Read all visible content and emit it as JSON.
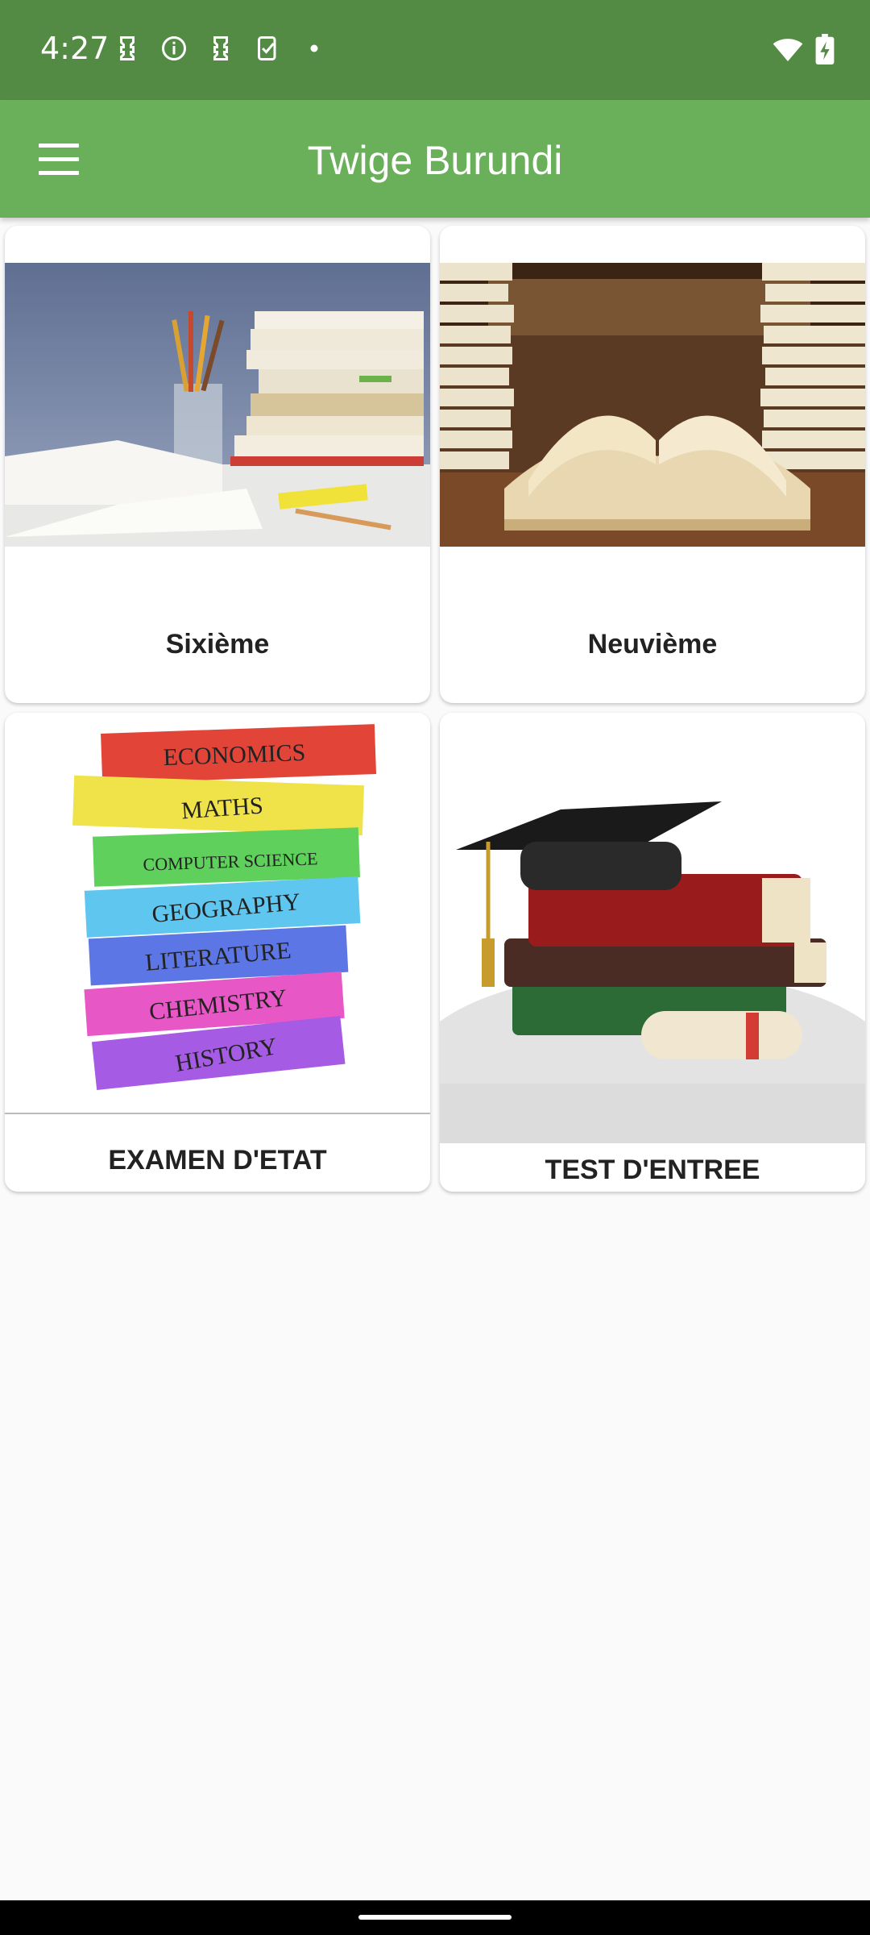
{
  "status_bar": {
    "time": "4:27",
    "left_icons": [
      "sim-icon",
      "info-icon",
      "sim-icon",
      "task-icon",
      "dot-icon"
    ],
    "right_icons": [
      "wifi-icon",
      "battery-charging-icon"
    ]
  },
  "app_bar": {
    "title": "Twige Burundi",
    "menu_icon": "hamburger-menu-icon",
    "color": "#6aaf5a"
  },
  "cards": [
    {
      "label": "Sixième",
      "image": "books-and-pencils-desk"
    },
    {
      "label": "Neuvième",
      "image": "open-book-library"
    },
    {
      "label": "EXAMEN D'ETAT",
      "image": "subject-book-stack",
      "book_spines": [
        "ECONOMICS",
        "MATHS",
        "COMPUTER SCIENCE",
        "GEOGRAPHY",
        "LITERATURE",
        "CHEMISTRY",
        "HISTORY"
      ]
    },
    {
      "label": "TEST D'ENTREE",
      "image": "graduation-cap-books-diploma"
    }
  ],
  "colors": {
    "status_bar": "#548b44",
    "app_bar": "#6aaf5a",
    "background": "#fafafa"
  }
}
